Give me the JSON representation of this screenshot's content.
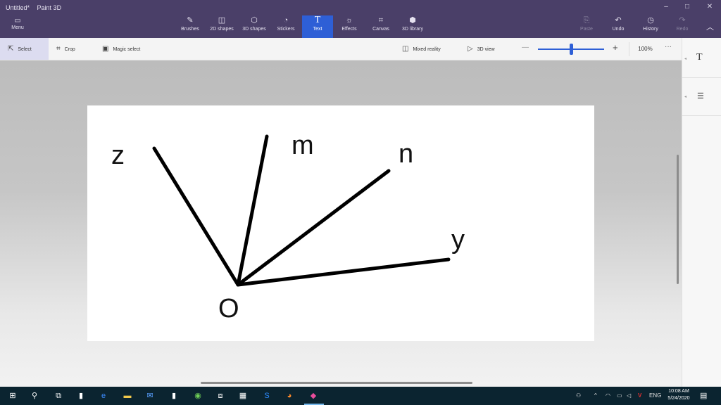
{
  "window": {
    "doc_title": "Untitled*",
    "app_name": "Paint 3D",
    "minimize": "–",
    "maximize": "□",
    "close": "✕"
  },
  "ribbon": {
    "menu_label": "Menu",
    "tools": [
      {
        "label": "Brushes",
        "icon": "brush-icon"
      },
      {
        "label": "2D shapes",
        "icon": "2d-shapes-icon"
      },
      {
        "label": "3D shapes",
        "icon": "3d-shapes-icon"
      },
      {
        "label": "Stickers",
        "icon": "stickers-icon"
      },
      {
        "label": "Text",
        "icon": "text-icon"
      },
      {
        "label": "Effects",
        "icon": "effects-icon"
      },
      {
        "label": "Canvas",
        "icon": "canvas-icon"
      },
      {
        "label": "3D library",
        "icon": "3d-library-icon"
      }
    ],
    "active_tool": "Text",
    "paste_label": "Paste",
    "undo_label": "Undo",
    "history_label": "History",
    "redo_label": "Redo"
  },
  "subbar": {
    "select_label": "Select",
    "crop_label": "Crop",
    "magic_select_label": "Magic select",
    "mixed_reality_label": "Mixed reality",
    "view3d_label": "3D view",
    "zoom_value": "100%",
    "zoom_fraction": 0.5,
    "more": "···"
  },
  "canvas": {
    "labels": {
      "z": "z",
      "m": "m",
      "n": "n",
      "y": "y",
      "o": "O"
    }
  },
  "taskbar": {
    "time": "10:08 AM",
    "date": "5/24/2020",
    "language": "ENG",
    "notifications": "1"
  },
  "colors": {
    "ribbon_bg": "#4a3f68",
    "accent": "#2e5fd6",
    "taskbar_bg": "#0b2430"
  }
}
